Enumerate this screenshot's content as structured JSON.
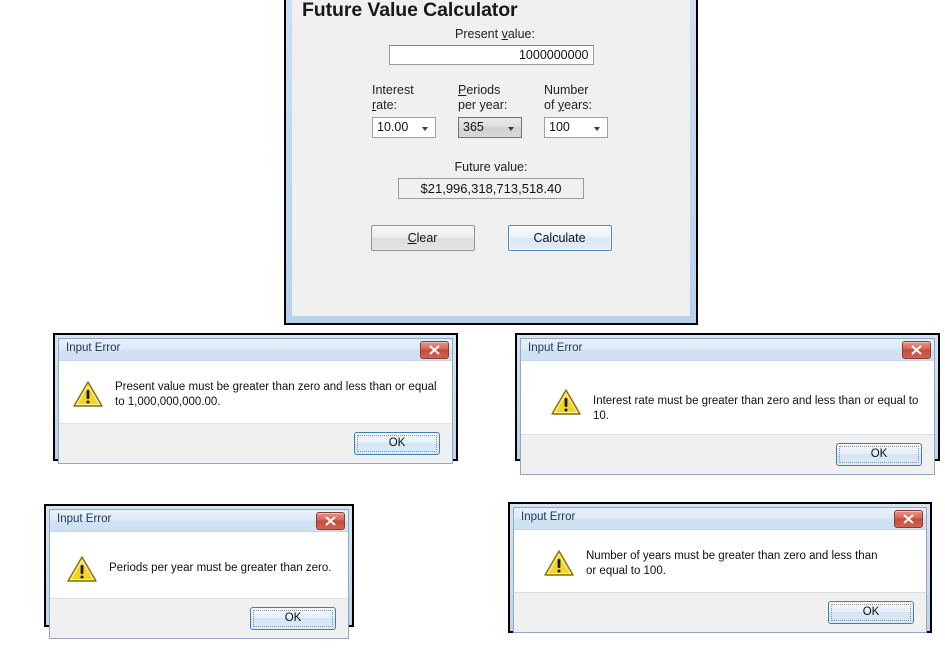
{
  "calculator": {
    "title": "Future Value Calculator",
    "present_value": {
      "label_pre": "Present ",
      "label_accel": "v",
      "label_post": "alue:",
      "value": "1000000000"
    },
    "interest_rate": {
      "label_line1": "Interest",
      "label_accel": "r",
      "label_line2_post": "ate:",
      "value": "10.00",
      "focused": false
    },
    "periods_per_year": {
      "label_accel": "P",
      "label_line1_post": "eriods",
      "label_line2": "per year:",
      "value": "365",
      "focused": true
    },
    "number_of_years": {
      "label_line1": "Number",
      "label_line2_pre": "of ",
      "label_accel": "y",
      "label_line2_post": "ears:",
      "value": "100",
      "focused": false
    },
    "future_value": {
      "label": "Future value:",
      "value": "$21,996,318,713,518.40"
    },
    "buttons": {
      "clear_pre": "",
      "clear_accel": "C",
      "clear_post": "lear",
      "calculate": "Calculate"
    },
    "colors": {
      "frame": "#c3d8ef",
      "client": "#f0f0f0",
      "focus_border": "#4d8ab5"
    }
  },
  "dialogs": [
    {
      "title": "Input Error",
      "message": "Present value must be greater than zero and less than or equal to 1,000,000,000.00.",
      "ok_label": "OK",
      "close_icon": "close-icon",
      "warning_icon": "warning-icon"
    },
    {
      "title": "Input Error",
      "message": "Interest rate must be greater than zero and less than or equal to 10.",
      "ok_label": "OK",
      "close_icon": "close-icon",
      "warning_icon": "warning-icon"
    },
    {
      "title": "Input Error",
      "message": "Periods per year must be greater than zero.",
      "ok_label": "OK",
      "close_icon": "close-icon",
      "warning_icon": "warning-icon"
    },
    {
      "title": "Input Error",
      "message": "Number of years must be greater than zero and less than or equal to 100.",
      "ok_label": "OK",
      "close_icon": "close-icon",
      "warning_icon": "warning-icon"
    }
  ]
}
